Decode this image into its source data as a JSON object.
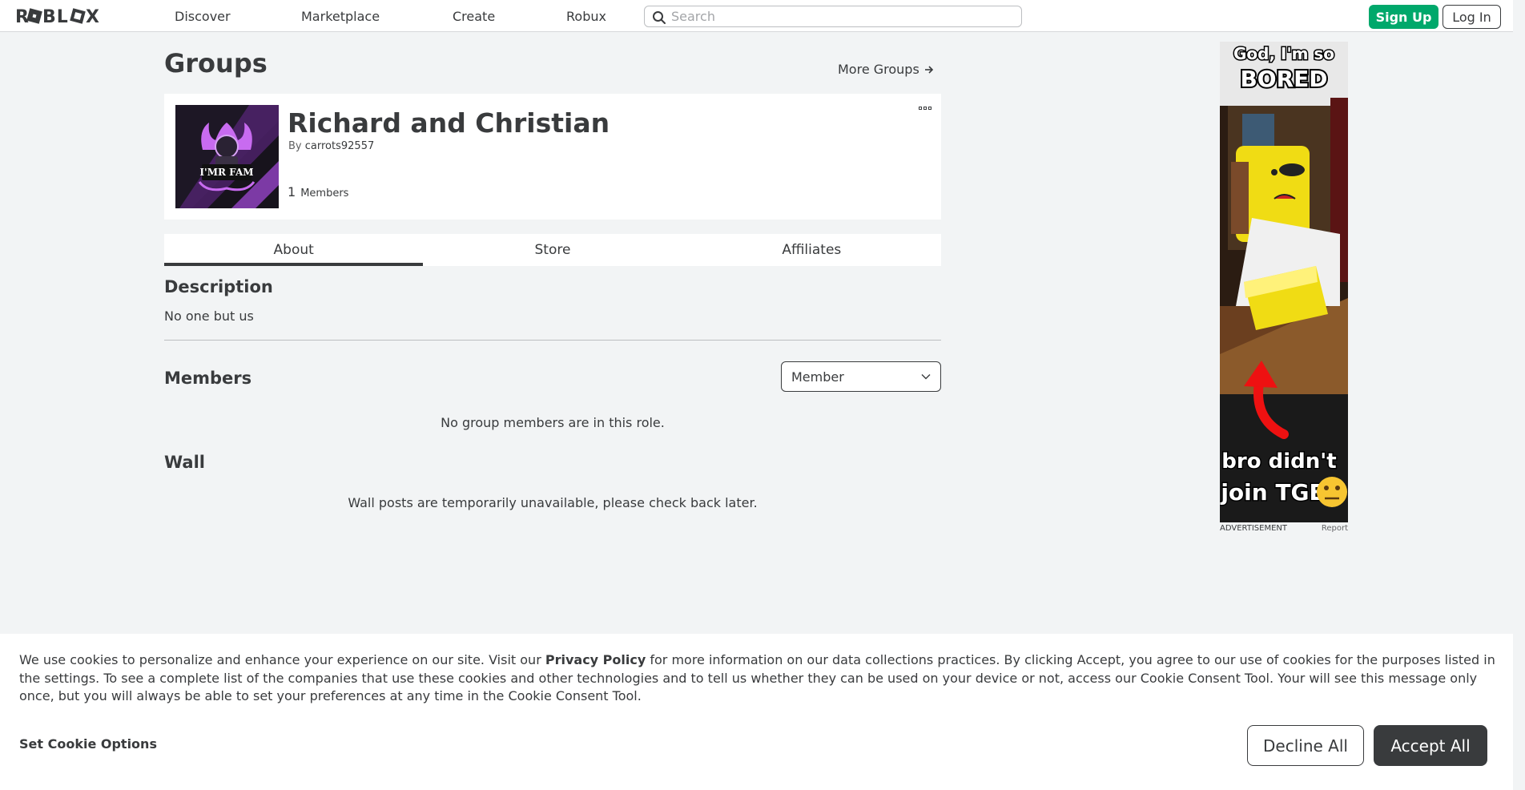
{
  "header": {
    "logo": "ROBLOX",
    "nav": [
      "Discover",
      "Marketplace",
      "Create",
      "Robux"
    ],
    "search_placeholder": "Search",
    "signup_label": "Sign Up",
    "login_label": "Log In"
  },
  "page": {
    "title": "Groups",
    "more_groups": "More Groups"
  },
  "group": {
    "name": "Richard and Christian",
    "by_label": "By",
    "owner": "carrots92557",
    "member_count": "1",
    "member_label": "Members",
    "emblem_text": "I'MR FAM"
  },
  "tabs": [
    "About",
    "Store",
    "Affiliates"
  ],
  "about": {
    "description_heading": "Description",
    "description_text": "No one but us",
    "members_heading": "Members",
    "role_selected": "Member",
    "no_members_msg": "No group members are in this role.",
    "wall_heading": "Wall",
    "wall_msg": "Wall posts are temporarily unavailable, please check back later."
  },
  "ad": {
    "top_text_1": "God, I'm so",
    "top_text_2": "BORED",
    "bottom_text_1": "bro didn't",
    "bottom_text_2": "join TGE",
    "label": "ADVERTISEMENT",
    "report": "Report"
  },
  "cookie": {
    "text_before": "We use cookies to personalize and enhance your experience on our site. Visit our ",
    "link": "Privacy Policy",
    "text_after": " for more information on our data collections practices. By clicking Accept, you agree to our use of cookies for the purposes listed in the settings. To see a complete list of the companies that use these cookies and other technologies and to tell us whether they can be used on your device or not, access our Cookie Consent Tool. Your will see this message only once, but you will always be able to set your preferences at any time in the Cookie Consent Tool.",
    "options": "Set Cookie Options",
    "decline": "Decline All",
    "accept": "Accept All"
  },
  "colors": {
    "accent_green": "#00a86b",
    "text_dark": "#393b3d",
    "background": "#f2f4f5"
  }
}
